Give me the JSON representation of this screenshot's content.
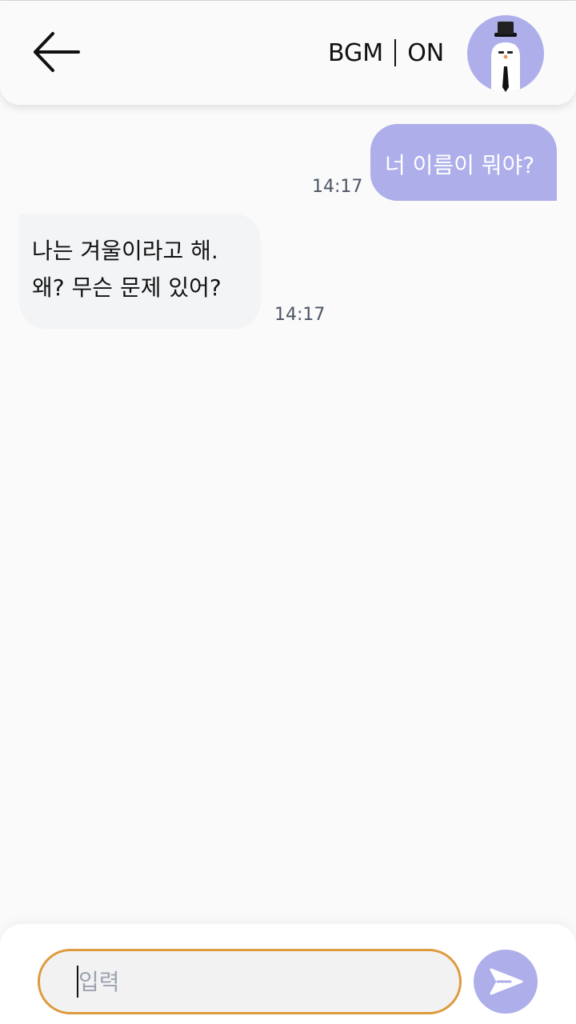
{
  "header": {
    "bgm_label": "BGM",
    "bgm_state": "ON",
    "back_icon": "arrow-left-icon",
    "avatar": "snowman-character-avatar"
  },
  "messages": [
    {
      "sender": "user",
      "text": "너 이름이 뭐야?",
      "time": "14:17"
    },
    {
      "sender": "bot",
      "lines": [
        "나는 겨울이라고 해.",
        "왜? 무슨 문제 있어?"
      ],
      "time": "14:17"
    }
  ],
  "composer": {
    "placeholder": "입력",
    "value": "",
    "send_icon": "send-arrow-icon"
  },
  "colors": {
    "accent": "#aeaeeb",
    "input_border": "#de9a3c",
    "bot_bubble": "#f3f4f6",
    "background": "#fafafa",
    "timestamp": "#4b5563"
  }
}
